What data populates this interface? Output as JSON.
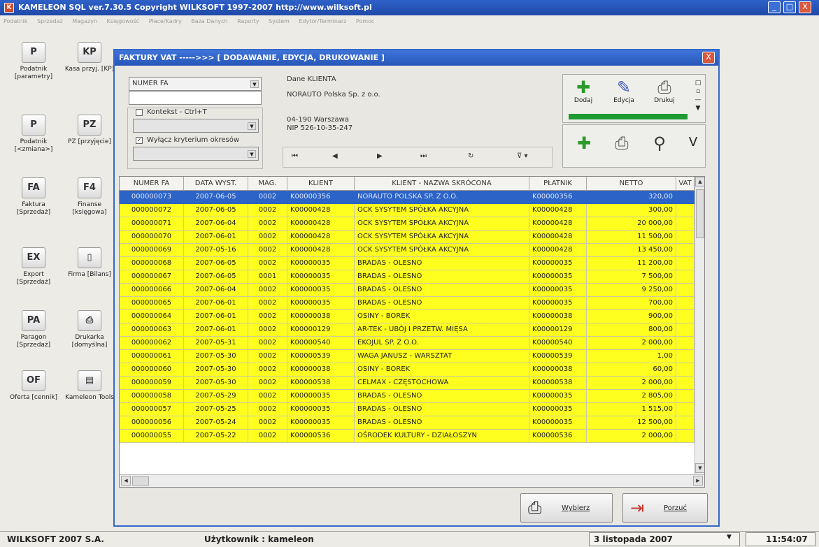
{
  "app": {
    "title": "KAMELEON SQL ver.7.30.5 Copyright WILKSOFT 1997-2007 http://www.wilksoft.pl",
    "icon_text": "K",
    "window_buttons": [
      "_",
      "□",
      "X"
    ]
  },
  "menu": [
    "Podatnik",
    "Sprzedaż",
    "Magazyn",
    "Księgowość",
    "Płace/Kadry",
    "Baza Danych",
    "Raporty",
    "System",
    "Edytor/Terminarz",
    "Pomoc"
  ],
  "launcher": [
    {
      "label": "Podatnik [parametry]",
      "icon": "P"
    },
    {
      "label": "Kasa przyj. [KP]",
      "icon": "KP"
    },
    {
      "label": "Podatnik [<zmiana>]",
      "icon": "P"
    },
    {
      "label": "PZ [przyjęcie]",
      "icon": "PZ"
    },
    {
      "label": "Faktura [Sprzedaż]",
      "icon": "FA"
    },
    {
      "label": "Finanse [księgowa]",
      "icon": "F4"
    },
    {
      "label": "Export [Sprzedaż]",
      "icon": "EX"
    },
    {
      "label": "Firma [Bilans]",
      "icon": "▯"
    },
    {
      "label": "Paragon [Sprzedaż]",
      "icon": "PA"
    },
    {
      "label": "Drukarka [domyślna]",
      "icon": "⎙"
    },
    {
      "label": "Oferta [cennik]",
      "icon": "OF"
    },
    {
      "label": "Kameleon Tools",
      "icon": "▤"
    }
  ],
  "dialog": {
    "title": "FAKTURY VAT ----->>> [ DODAWANIE, EDYCJA, DRUKOWANIE ]",
    "sort_combo": "NUMER FA",
    "search_value": "",
    "context_label": "Kontekst - Ctrl+T",
    "context_checked": false,
    "period_label": "Wyłącz kryterium okresów",
    "period_checked": true,
    "client_header": "Dane KLIENTA",
    "client_name": "NORAUTO Polska Sp. z o.o.",
    "client_address": "04-190  Warszawa",
    "client_nip": "NIP    526-10-35-247",
    "nav": [
      "⏮",
      "◀",
      "▶",
      "⏭",
      "↻",
      "⊽ ▾"
    ],
    "toolbar": {
      "add": "Dodaj",
      "edit": "Edycja",
      "print": "Drukuj",
      "v_label": "V"
    },
    "columns": [
      "NUMER FA",
      "DATA WYST.",
      "MAG.",
      "KLIENT",
      "KLIENT - NAZWA SKRÓCONA",
      "PŁATNIK",
      "NETTO",
      "VAT"
    ],
    "rows": [
      [
        "000000073",
        "2007-06-05",
        "0002",
        "K00000356",
        "NORAUTO POLSKA SP. Z O.O.",
        "K00000356",
        "320,00"
      ],
      [
        "000000072",
        "2007-06-05",
        "0002",
        "K00000428",
        "OCK SYSYTEM SPÓŁKA AKCYJNA",
        "K00000428",
        "300,00"
      ],
      [
        "000000071",
        "2007-06-04",
        "0002",
        "K00000428",
        "OCK SYSYTEM SPÓŁKA AKCYJNA",
        "K00000428",
        "20 000,00"
      ],
      [
        "000000070",
        "2007-06-01",
        "0002",
        "K00000428",
        "OCK SYSYTEM SPÓŁKA AKCYJNA",
        "K00000428",
        "11 500,00"
      ],
      [
        "000000069",
        "2007-05-16",
        "0002",
        "K00000428",
        "OCK SYSYTEM SPÓŁKA AKCYJNA",
        "K00000428",
        "13 450,00"
      ],
      [
        "000000068",
        "2007-06-05",
        "0002",
        "K00000035",
        "BRADAS - OLESNO",
        "K00000035",
        "11 200,00"
      ],
      [
        "000000067",
        "2007-06-05",
        "0001",
        "K00000035",
        "BRADAS - OLESNO",
        "K00000035",
        "7 500,00"
      ],
      [
        "000000066",
        "2007-06-04",
        "0002",
        "K00000035",
        "BRADAS - OLESNO",
        "K00000035",
        "9 250,00"
      ],
      [
        "000000065",
        "2007-06-01",
        "0002",
        "K00000035",
        "BRADAS - OLESNO",
        "K00000035",
        "700,00"
      ],
      [
        "000000064",
        "2007-06-01",
        "0002",
        "K00000038",
        "OSINY - BOREK",
        "K00000038",
        "900,00"
      ],
      [
        "000000063",
        "2007-06-01",
        "0002",
        "K00000129",
        "AR-TEK - UBÓJ I PRZETW. MIĘSA",
        "K00000129",
        "800,00"
      ],
      [
        "000000062",
        "2007-05-31",
        "0002",
        "K00000540",
        "EKOJUL SP. Z O.O.",
        "K00000540",
        "2 000,00"
      ],
      [
        "000000061",
        "2007-05-30",
        "0002",
        "K00000539",
        "WAGA JANUSZ - WARSZTAT",
        "K00000539",
        "1,00"
      ],
      [
        "000000060",
        "2007-05-30",
        "0002",
        "K00000038",
        "OSINY - BOREK",
        "K00000038",
        "60,00"
      ],
      [
        "000000059",
        "2007-05-30",
        "0002",
        "K00000538",
        "CELMAX - CZĘSTOCHOWA",
        "K00000538",
        "2 000,00"
      ],
      [
        "000000058",
        "2007-05-29",
        "0002",
        "K00000035",
        "BRADAS - OLESNO",
        "K00000035",
        "2 805,00"
      ],
      [
        "000000057",
        "2007-05-25",
        "0002",
        "K00000035",
        "BRADAS - OLESNO",
        "K00000035",
        "1 515,00"
      ],
      [
        "000000056",
        "2007-05-24",
        "0002",
        "K00000035",
        "BRADAS - OLESNO",
        "K00000035",
        "12 500,00"
      ],
      [
        "000000055",
        "2007-05-22",
        "0002",
        "K00000536",
        "OŚRODEK KULTURY - DZIAŁOSZYN",
        "K00000536",
        "2 000,00"
      ]
    ],
    "select_button": "Wybierz",
    "cancel_button": "Porzuć"
  },
  "statusbar": {
    "company": "WILKSOFT 2007  S.A.",
    "user": "Użytkownik : kameleon",
    "date": "3   listopada   2007",
    "time": "11:54:07"
  },
  "colors": {
    "row_yellow": "#ffff1f",
    "selection_blue": "#2c63c6",
    "title_blue": "#2756b8"
  }
}
